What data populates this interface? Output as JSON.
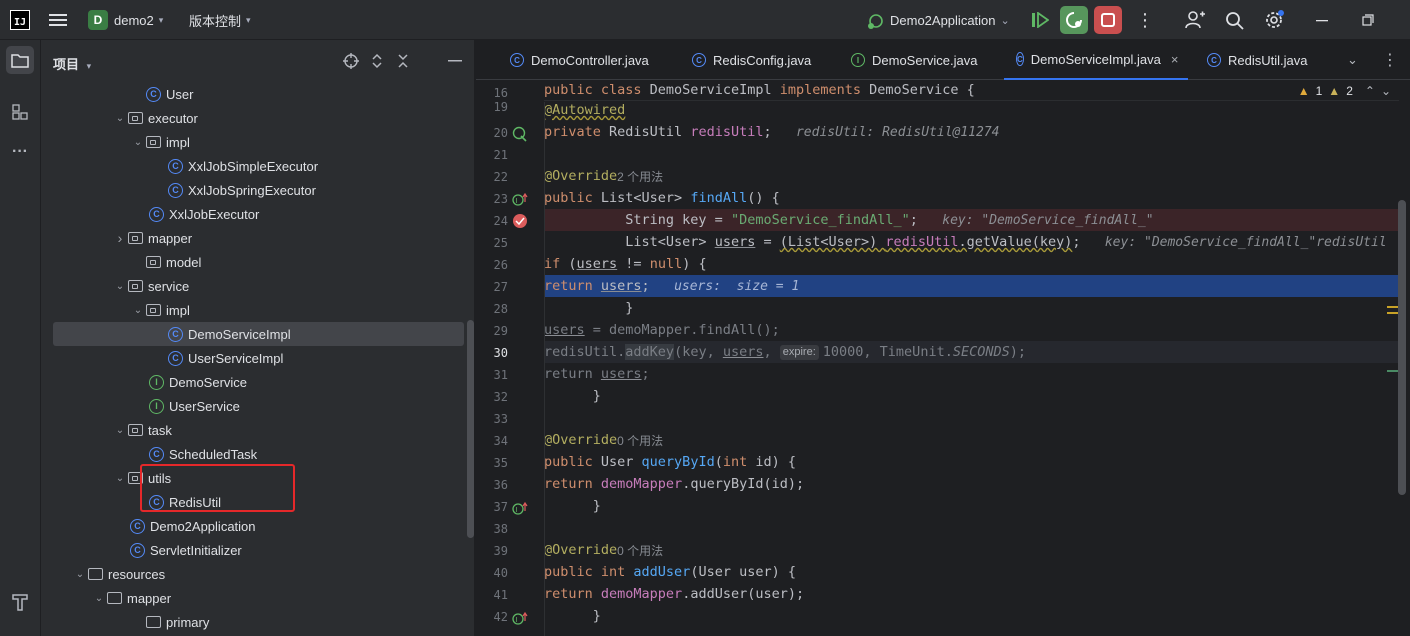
{
  "titlebar": {
    "logo": "IJ",
    "project_badge": "D",
    "project_name": "demo2",
    "vcs_label": "版本控制",
    "run_config": "Demo2Application"
  },
  "project_panel": {
    "title": "项目",
    "tree": [
      {
        "label": "User",
        "kind": "class"
      },
      {
        "label": "executor",
        "kind": "package",
        "expanded": true
      },
      {
        "label": "impl",
        "kind": "package",
        "expanded": true
      },
      {
        "label": "XxlJobSimpleExecutor",
        "kind": "class"
      },
      {
        "label": "XxlJobSpringExecutor",
        "kind": "class"
      },
      {
        "label": "XxlJobExecutor",
        "kind": "class"
      },
      {
        "label": "mapper",
        "kind": "package",
        "expanded": false
      },
      {
        "label": "model",
        "kind": "package"
      },
      {
        "label": "service",
        "kind": "package",
        "expanded": true
      },
      {
        "label": "impl",
        "kind": "package",
        "expanded": true
      },
      {
        "label": "DemoServiceImpl",
        "kind": "class",
        "selected": true
      },
      {
        "label": "UserServiceImpl",
        "kind": "class"
      },
      {
        "label": "DemoService",
        "kind": "interface"
      },
      {
        "label": "UserService",
        "kind": "interface"
      },
      {
        "label": "task",
        "kind": "package",
        "expanded": true
      },
      {
        "label": "ScheduledTask",
        "kind": "class"
      },
      {
        "label": "utils",
        "kind": "package",
        "expanded": true
      },
      {
        "label": "RedisUtil",
        "kind": "class"
      },
      {
        "label": "Demo2Application",
        "kind": "class"
      },
      {
        "label": "ServletInitializer",
        "kind": "class"
      },
      {
        "label": "resources",
        "kind": "folder",
        "expanded": true
      },
      {
        "label": "mapper",
        "kind": "folder",
        "expanded": true
      },
      {
        "label": "primary",
        "kind": "folder"
      }
    ]
  },
  "editor": {
    "tabs": [
      {
        "label": "DemoController.java",
        "kind": "class"
      },
      {
        "label": "RedisConfig.java",
        "kind": "class"
      },
      {
        "label": "DemoService.java",
        "kind": "interface"
      },
      {
        "label": "DemoServiceImpl.java",
        "kind": "class",
        "active": true
      },
      {
        "label": "RedisUtil.java",
        "kind": "class"
      }
    ],
    "warnings": "1",
    "weak_warnings": "2",
    "sticky_line": "16",
    "line_numbers": [
      "19",
      "20",
      "21",
      "22",
      "23",
      "24",
      "25",
      "26",
      "27",
      "28",
      "29",
      "30",
      "31",
      "32",
      "33",
      "34",
      "35",
      "36",
      "37",
      "38",
      "39",
      "40",
      "41",
      "42"
    ],
    "hints": {
      "redis_util": "redisUtil: RedisUtil@11274",
      "usages_2": "2 个用法",
      "key_value": "key: \"DemoService_findAll_\"",
      "redis_util_short": "redisUtil",
      "users_size": "users:  size = 1",
      "expire_param": "expire:",
      "usages_0": "0 个用法"
    }
  },
  "colors": {
    "accent": "#3574f0",
    "breakpoint": "#db5c5c",
    "execution_line": "#214283",
    "breakpoint_line": "#3b2428",
    "highlight_box": "#e5282a"
  }
}
